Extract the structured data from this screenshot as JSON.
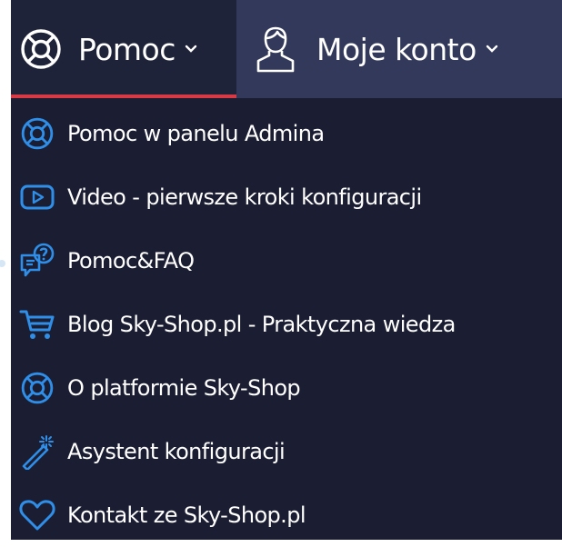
{
  "colors": {
    "accent": "#2f8ee8",
    "active_underline": "#d83a45",
    "panel_bg": "#1b1e33",
    "topbar_bg": "#33395a"
  },
  "topbar": {
    "help_tab": {
      "label": "Pomoc",
      "icon": "lifebuoy-icon"
    },
    "account_tab": {
      "label": "Moje konto",
      "icon": "user-icon"
    }
  },
  "menu": {
    "items": [
      {
        "label": "Pomoc w panelu Admina",
        "icon": "lifebuoy-icon"
      },
      {
        "label": "Video - pierwsze kroki konfiguracji",
        "icon": "video-play-icon"
      },
      {
        "label": "Pomoc&FAQ",
        "icon": "faq-chat-icon"
      },
      {
        "label": "Blog Sky-Shop.pl - Praktyczna wiedza",
        "icon": "cart-icon"
      },
      {
        "label": "O platformie Sky-Shop",
        "icon": "lifebuoy-icon"
      },
      {
        "label": "Asystent konfiguracji",
        "icon": "magic-wand-icon"
      },
      {
        "label": "Kontakt ze Sky-Shop.pl",
        "icon": "heart-icon"
      }
    ]
  }
}
